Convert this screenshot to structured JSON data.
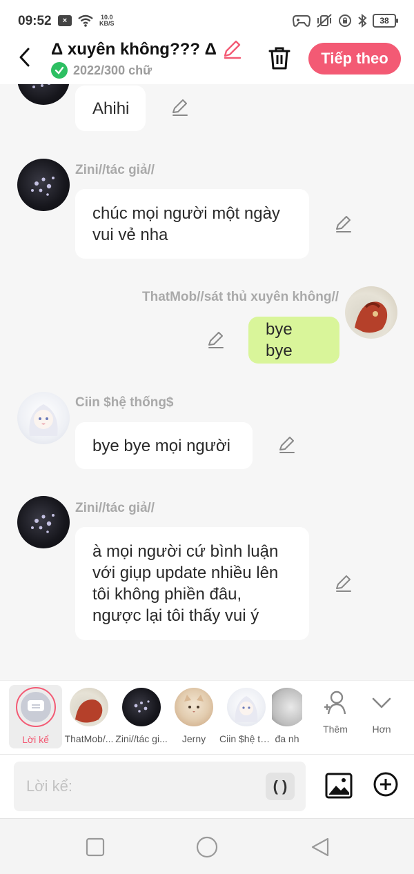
{
  "status_bar": {
    "time": "09:52",
    "x_badge": "×",
    "net_speed_top": "10.0",
    "net_speed_bottom": "KB/S",
    "battery": "38"
  },
  "header": {
    "title": "Δ xuyên không??? Δ",
    "word_count": "2022/300 chữ",
    "next_label": "Tiếp theo"
  },
  "messages": [
    {
      "text": "Ahihi"
    },
    {
      "name": "Zini//tác giả//",
      "text": "chúc mọi người một ngày vui vẻ nha"
    },
    {
      "name": "ThatMob//sát thủ xuyên không//",
      "text": "bye bye"
    },
    {
      "name": "Ciin $hệ thống$",
      "text": "bye bye mọi người"
    },
    {
      "name": "Zini//tác giả//",
      "text": "à mọi người cứ bình luận với giụp update nhiều lên tôi không phiền đâu, ngược lại tôi thấy vui ý"
    }
  ],
  "characters": [
    {
      "label": "Lời kể"
    },
    {
      "label": "ThatMob/..."
    },
    {
      "label": "Zini//tác gi..."
    },
    {
      "label": "Jerny"
    },
    {
      "label": "Ciin $hệ th..."
    },
    {
      "label": "đa nh"
    }
  ],
  "actions": {
    "add_label": "Thêm",
    "more_label": "Hơn"
  },
  "input": {
    "placeholder": "Lời kể:",
    "paren": "( )"
  },
  "colors": {
    "accent": "#f35a74",
    "my_bubble": "#d9f59a",
    "check_green": "#2dbf62"
  }
}
